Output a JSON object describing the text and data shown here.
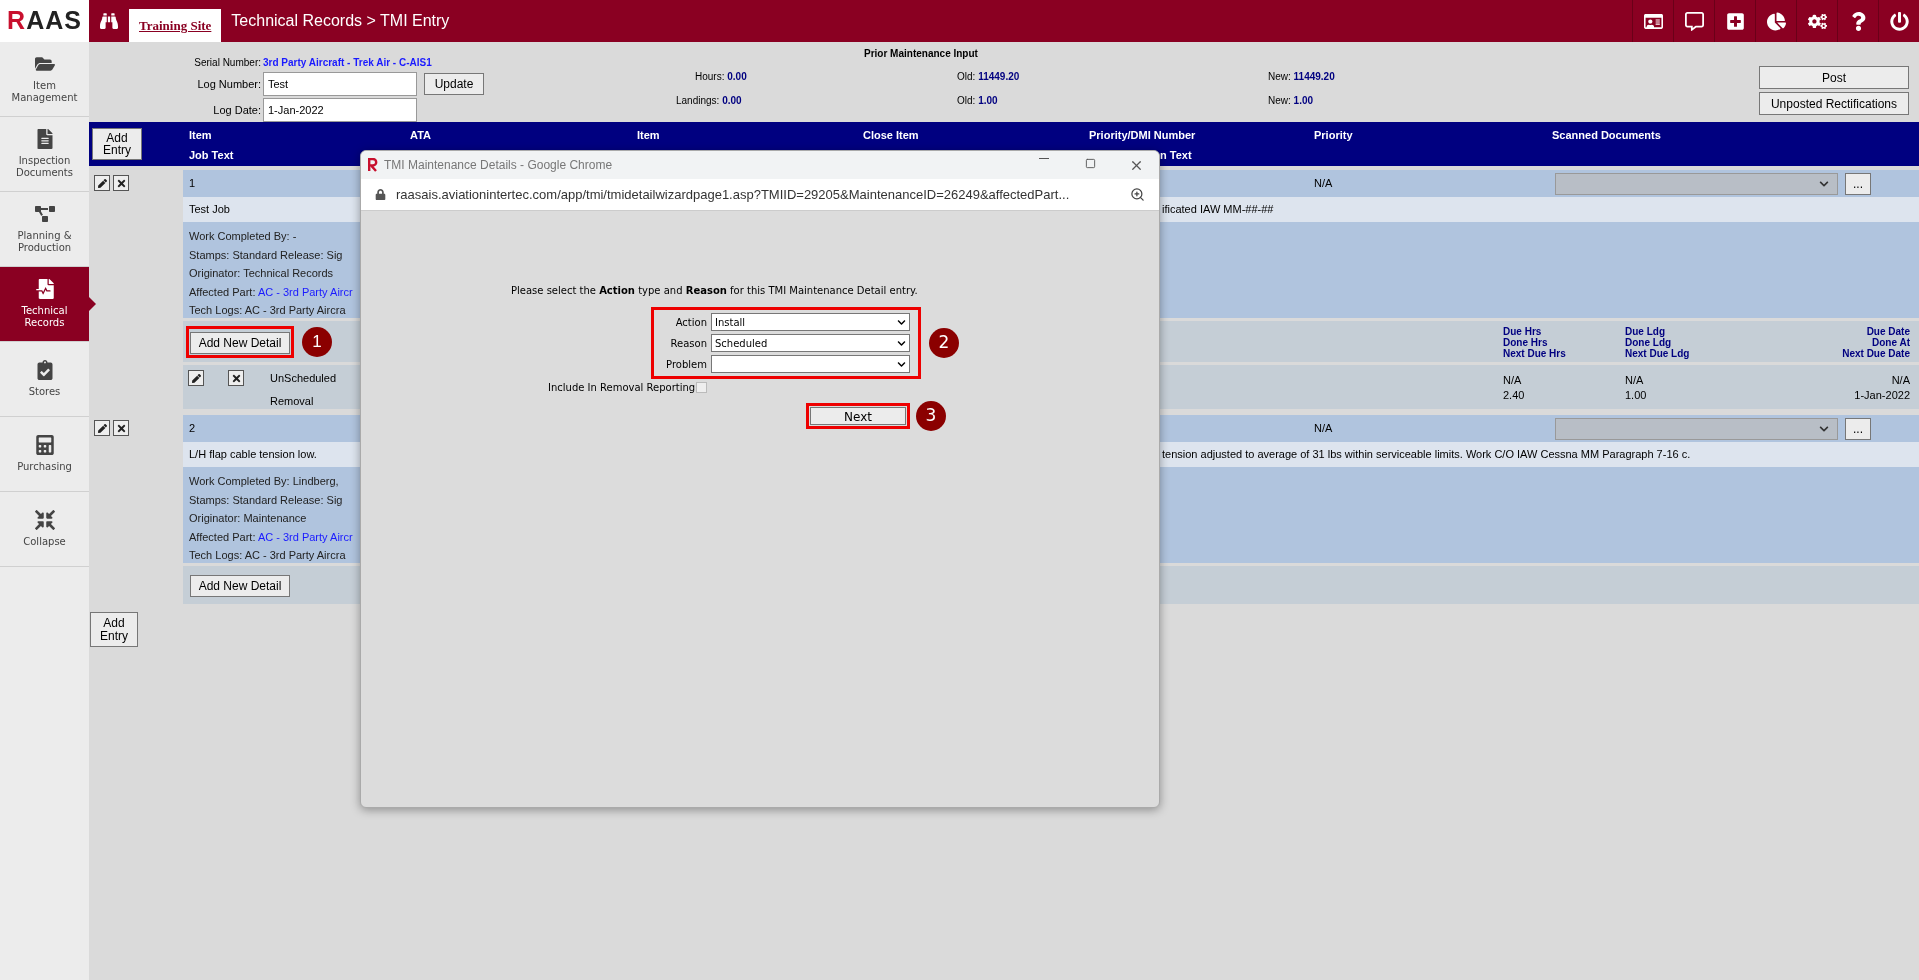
{
  "logo": "RAAS",
  "site_tab": "Training Site",
  "breadcrumb": "Technical Records > TMI Entry",
  "sidebar": {
    "items": [
      {
        "label": "Item Management",
        "selected": false
      },
      {
        "label": "Inspection Documents",
        "selected": false
      },
      {
        "label": "Planning & Production",
        "selected": false
      },
      {
        "label": "Technical Records",
        "selected": true
      },
      {
        "label": "Stores",
        "selected": false
      },
      {
        "label": "Purchasing",
        "selected": false
      },
      {
        "label": "Collapse",
        "selected": false
      }
    ]
  },
  "header": {
    "serial_label": "Serial Number:",
    "serial_value": "3rd Party Aircraft - Trek Air - C-AIS1",
    "log_number": {
      "label": "Log Number:",
      "value": "Test"
    },
    "update_button": "Update",
    "log_date": {
      "label": "Log Date:",
      "value": "1-Jan-2022"
    },
    "prior_title": "Prior Maintenance Input",
    "hours": {
      "label": "Hours:",
      "value": "0.00"
    },
    "landings": {
      "label": "Landings:",
      "value": "0.00"
    },
    "old_hours": {
      "label": "Old:",
      "value": "11449.20"
    },
    "old_landings": {
      "label": "Old:",
      "value": "1.00"
    },
    "new_hours": {
      "label": "New:",
      "value": "11449.20"
    },
    "new_landings": {
      "label": "New:",
      "value": "1.00"
    },
    "post_button": "Post",
    "unposted_button": "Unposted Rectifications"
  },
  "table": {
    "add_entry": "Add Entry",
    "columns": [
      "Item",
      "ATA",
      "Item",
      "Close Item",
      "Priority/DMI Number",
      "Priority",
      "Scanned Documents"
    ],
    "columns_line2": [
      "Job Text",
      "n Text"
    ]
  },
  "entries": [
    {
      "number": "1",
      "priority": "N/A",
      "more_button": "...",
      "job_text": "Test Job",
      "close_text": "ificated IAW MM-##-##",
      "details": [
        {
          "kind": "text",
          "text": "Work Completed By: -"
        },
        {
          "kind": "text",
          "text": "Stamps: Standard Release: Sig"
        },
        {
          "kind": "text",
          "text": "Originator: Technical Records"
        },
        {
          "kind": "link",
          "text": "Affected Part:",
          "link": "AC - 3rd Party Aircr"
        },
        {
          "kind": "text",
          "text": "Tech Logs: AC - 3rd Party Aircra"
        }
      ],
      "add_detail": {
        "label": "Add New Detail",
        "highlighted": true,
        "marker": "1"
      },
      "detail_header": {
        "hrs": [
          "Due Hrs",
          "Done Hrs",
          "Next Due Hrs"
        ],
        "ldg": [
          "Due Ldg",
          "Done Ldg",
          "Next Due Ldg"
        ],
        "date": [
          "Due Date",
          "Done At",
          "Next Due Date"
        ]
      },
      "detail_rows": [
        {
          "reason": "UnScheduled",
          "action": "Removal",
          "hrs": [
            "N/A",
            "2.40"
          ],
          "ldg": [
            "N/A",
            "1.00"
          ],
          "date": [
            "N/A",
            "1-Jan-2022"
          ]
        }
      ]
    },
    {
      "number": "2",
      "priority": "N/A",
      "more_button": "...",
      "job_text": "L/H flap cable tension low.",
      "close_text": "tension adjusted to average of 31 lbs within serviceable limits. Work C/O IAW Cessna MM Paragraph 7-16 c.",
      "details": [
        {
          "kind": "text",
          "text": "Work Completed By: Lindberg,"
        },
        {
          "kind": "text",
          "text": "Stamps: Standard Release: Sig"
        },
        {
          "kind": "text",
          "text": "Originator: Maintenance"
        },
        {
          "kind": "link",
          "text": "Affected Part:",
          "link": "AC - 3rd Party Aircr"
        },
        {
          "kind": "text",
          "text": "Tech Logs: AC - 3rd Party Aircra"
        }
      ],
      "add_detail": {
        "label": "Add New Detail",
        "highlighted": false
      }
    }
  ],
  "add_entry_bottom": "Add Entry",
  "dialog": {
    "title": "TMI Maintenance Details - Google Chrome",
    "url": "raasais.aviationintertec.com/app/tmi/tmidetailwizardpage1.asp?TMIID=29205&MaintenanceID=26249&affectedPart...",
    "prompt": "Please select the **Action** type and **Reason** for this TMI Maintenance Detail entry.",
    "fields": [
      {
        "label": "Action",
        "value": "Install"
      },
      {
        "label": "Reason",
        "value": "Scheduled"
      },
      {
        "label": "Problem"
      }
    ],
    "fields_highlighted": true,
    "fields_marker": "2",
    "checkbox": {
      "label": "Include In Removal Reporting",
      "checked": false
    },
    "next_button": {
      "label": "Next",
      "highlighted": true,
      "marker": "3"
    }
  }
}
